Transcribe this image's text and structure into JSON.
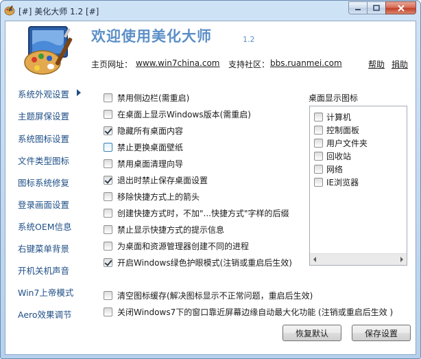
{
  "window": {
    "title": "[#] 美化大师 1.2 [#]"
  },
  "header": {
    "welcome": "欢迎使用美化大师",
    "version": "1.2",
    "homepage_label": "主页网址：",
    "homepage_url": "www.win7china.com",
    "support_label": "支持社区：",
    "support_url": "bbs.ruanmei.com",
    "help": "帮助",
    "donate": "捐助"
  },
  "sidebar": {
    "items": [
      {
        "label": "系统外观设置",
        "active": true
      },
      {
        "label": "主题屏保设置"
      },
      {
        "label": "系统图标设置"
      },
      {
        "label": "文件类型图标"
      },
      {
        "label": "图标系统修复"
      },
      {
        "label": "登录画面设置"
      },
      {
        "label": "系统OEM信息"
      },
      {
        "label": "右键菜单背景"
      },
      {
        "label": "开机关机声音"
      },
      {
        "label": "Win7上帝模式"
      },
      {
        "label": "Aero效果调节"
      }
    ]
  },
  "options": [
    {
      "label": "禁用侧边栏(需重启)",
      "checked": false
    },
    {
      "label": "在桌面上显示Windows版本(需重启)",
      "checked": false
    },
    {
      "label": "隐藏所有桌面内容",
      "checked": true
    },
    {
      "label": "禁止更换桌面壁纸",
      "checked": false,
      "focused": true
    },
    {
      "label": "禁用桌面清理向导",
      "checked": false
    },
    {
      "label": "退出时禁止保存桌面设置",
      "checked": true
    },
    {
      "label": "移除快捷方式上的箭头",
      "checked": false
    },
    {
      "label": "创建快捷方式时，不加\"...快捷方式\"字样的后缀",
      "checked": false
    },
    {
      "label": "禁止显示快捷方式的提示信息",
      "checked": false
    },
    {
      "label": "为桌面和资源管理器创建不同的进程",
      "checked": false
    },
    {
      "label": "开启Windows绿色护眼模式(注销或重启后生效)",
      "checked": true
    },
    {
      "label": "清空图标缓存(解决图标显示不正常问题，重启后生效)",
      "checked": false
    },
    {
      "label": "关闭Windows7下的窗口靠近屏幕边缘自动最大化功能 (注销或重启后生效 )",
      "checked": false
    }
  ],
  "desktop_icons": {
    "title": "桌面显示图标",
    "items": [
      {
        "label": "计算机",
        "checked": false
      },
      {
        "label": "控制面板",
        "checked": false
      },
      {
        "label": "用户文件夹",
        "checked": false
      },
      {
        "label": "回收站",
        "checked": false
      },
      {
        "label": "网络",
        "checked": false
      },
      {
        "label": "IE浏览器",
        "checked": false
      }
    ]
  },
  "buttons": {
    "restore": "恢复默认",
    "save": "保存设置"
  },
  "colors": {
    "accent": "#5b8fc7",
    "nav_text": "#1e4e86",
    "close": "#c2412a"
  }
}
